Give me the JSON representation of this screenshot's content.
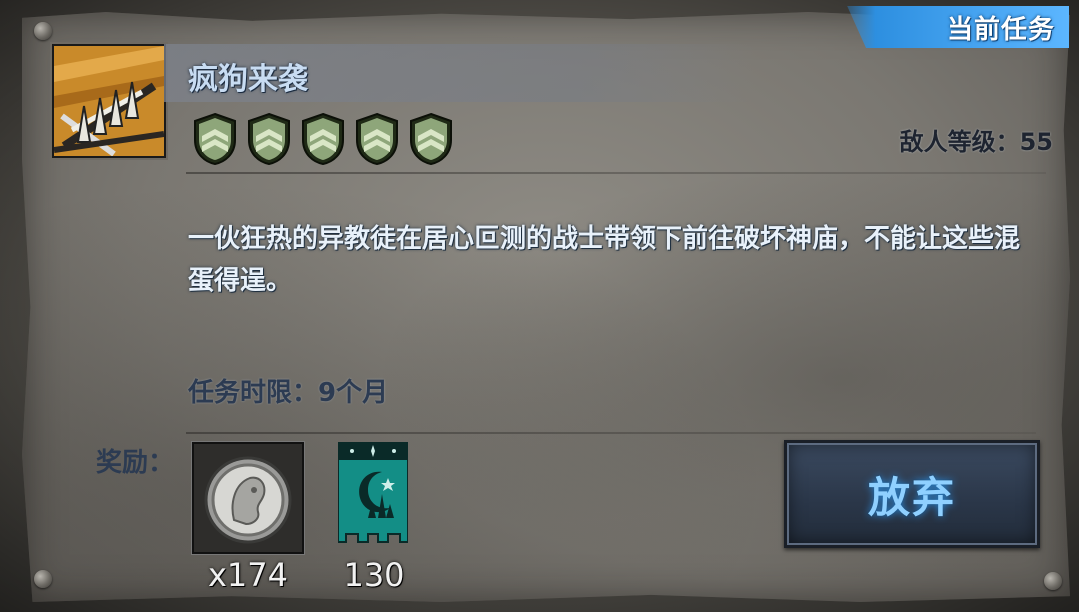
{
  "panel": {
    "banner_label": "当前任务"
  },
  "quest": {
    "title": "疯狗来袭",
    "difficulty_shields": 5,
    "enemy_level_label": "敌人等级：55",
    "description": "一伙狂热的异教徒在居心叵测的战士带领下前往破坏神庙，不能让这些混蛋得逞。",
    "time_limit_label": "任务时限：9个月"
  },
  "rewards": {
    "label": "奖励：",
    "items": [
      {
        "icon": "silver-coin-icon",
        "count": "x174"
      },
      {
        "icon": "moon-banner-icon",
        "count": "130"
      }
    ]
  },
  "actions": {
    "abandon_label": "放弃"
  },
  "colors": {
    "banner_blue": "#2d8fe0",
    "title_text": "#c8dcf2",
    "button_glow": "#8fd0ff",
    "shield_green": "#5f7a4a"
  }
}
